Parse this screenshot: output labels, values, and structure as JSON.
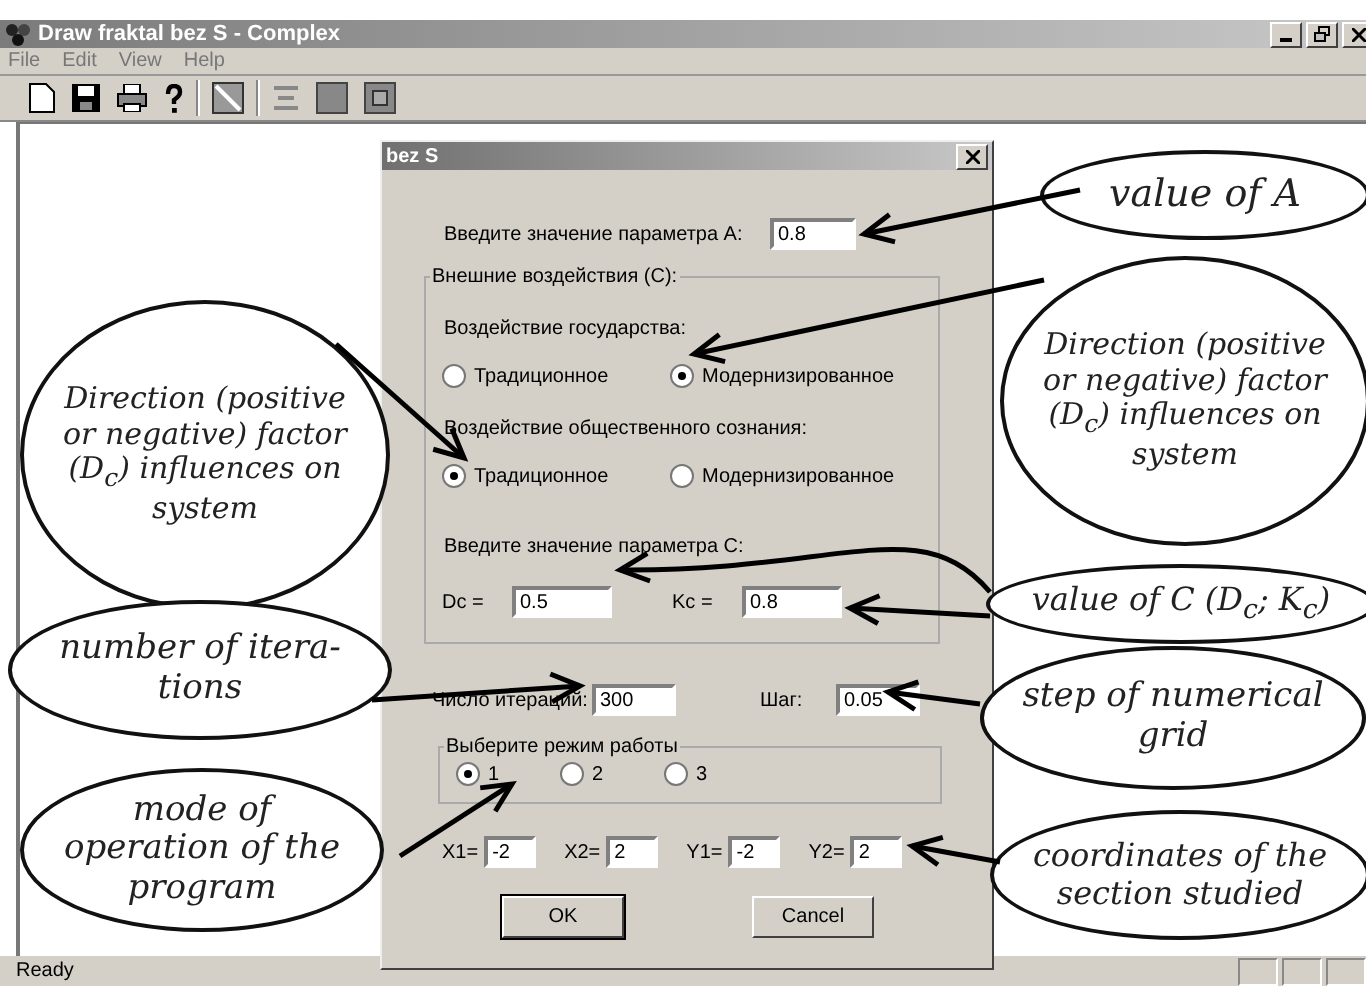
{
  "window": {
    "title": "Draw fraktal bez S - Complex"
  },
  "menu": [
    "File",
    "Edit",
    "View",
    "Help"
  ],
  "dialog": {
    "title": "bez S",
    "param_a": {
      "label": "Введите значение параметра А:",
      "value": "0.8"
    },
    "group_c": {
      "legend": "Внешние воздействия (С):",
      "sections": [
        {
          "label": "Воздействие государства:",
          "options": [
            {
              "label": "Традиционное",
              "selected": false
            },
            {
              "label": "Модернизированное",
              "selected": true
            }
          ]
        },
        {
          "label": "Воздействие общественного сознания:",
          "options": [
            {
              "label": "Традиционное",
              "selected": true
            },
            {
              "label": "Модернизированное",
              "selected": false
            }
          ]
        }
      ],
      "param_c_label": "Введите значение параметра С:",
      "fields": [
        {
          "label": "Dc =",
          "value": "0.5"
        },
        {
          "label": "Kc =",
          "value": "0.8"
        }
      ]
    },
    "iterations": {
      "label": "Число итераций:",
      "value": "300"
    },
    "step": {
      "label": "Шаг:",
      "value": "0.05"
    },
    "mode": {
      "legend": "Выберите режим работы",
      "options": [
        {
          "label": "1",
          "selected": true
        },
        {
          "label": "2",
          "selected": false
        },
        {
          "label": "3",
          "selected": false
        }
      ]
    },
    "coords": [
      {
        "label": "X1=",
        "value": "-2"
      },
      {
        "label": "X2=",
        "value": "2"
      },
      {
        "label": "Y1=",
        "value": "-2"
      },
      {
        "label": "Y2=",
        "value": "2"
      }
    ],
    "buttons": [
      "OK",
      "Cancel"
    ]
  },
  "annotations": [
    {
      "text": "value of A"
    },
    {
      "text": "Direction (positive or negative) factor (D$_{c}$) influences on system"
    },
    {
      "text": "value of C (D$_{c}$; K$_{c}$)"
    },
    {
      "text": "step of numerical grid"
    },
    {
      "text": "coordinates of the section studied"
    },
    {
      "text": "Direction (positive or negative) factor (D$_{c}$) influences on system"
    },
    {
      "text": "number of itera- tions"
    },
    {
      "text": "mode of operation of the program"
    }
  ],
  "status_bar": "Ready"
}
